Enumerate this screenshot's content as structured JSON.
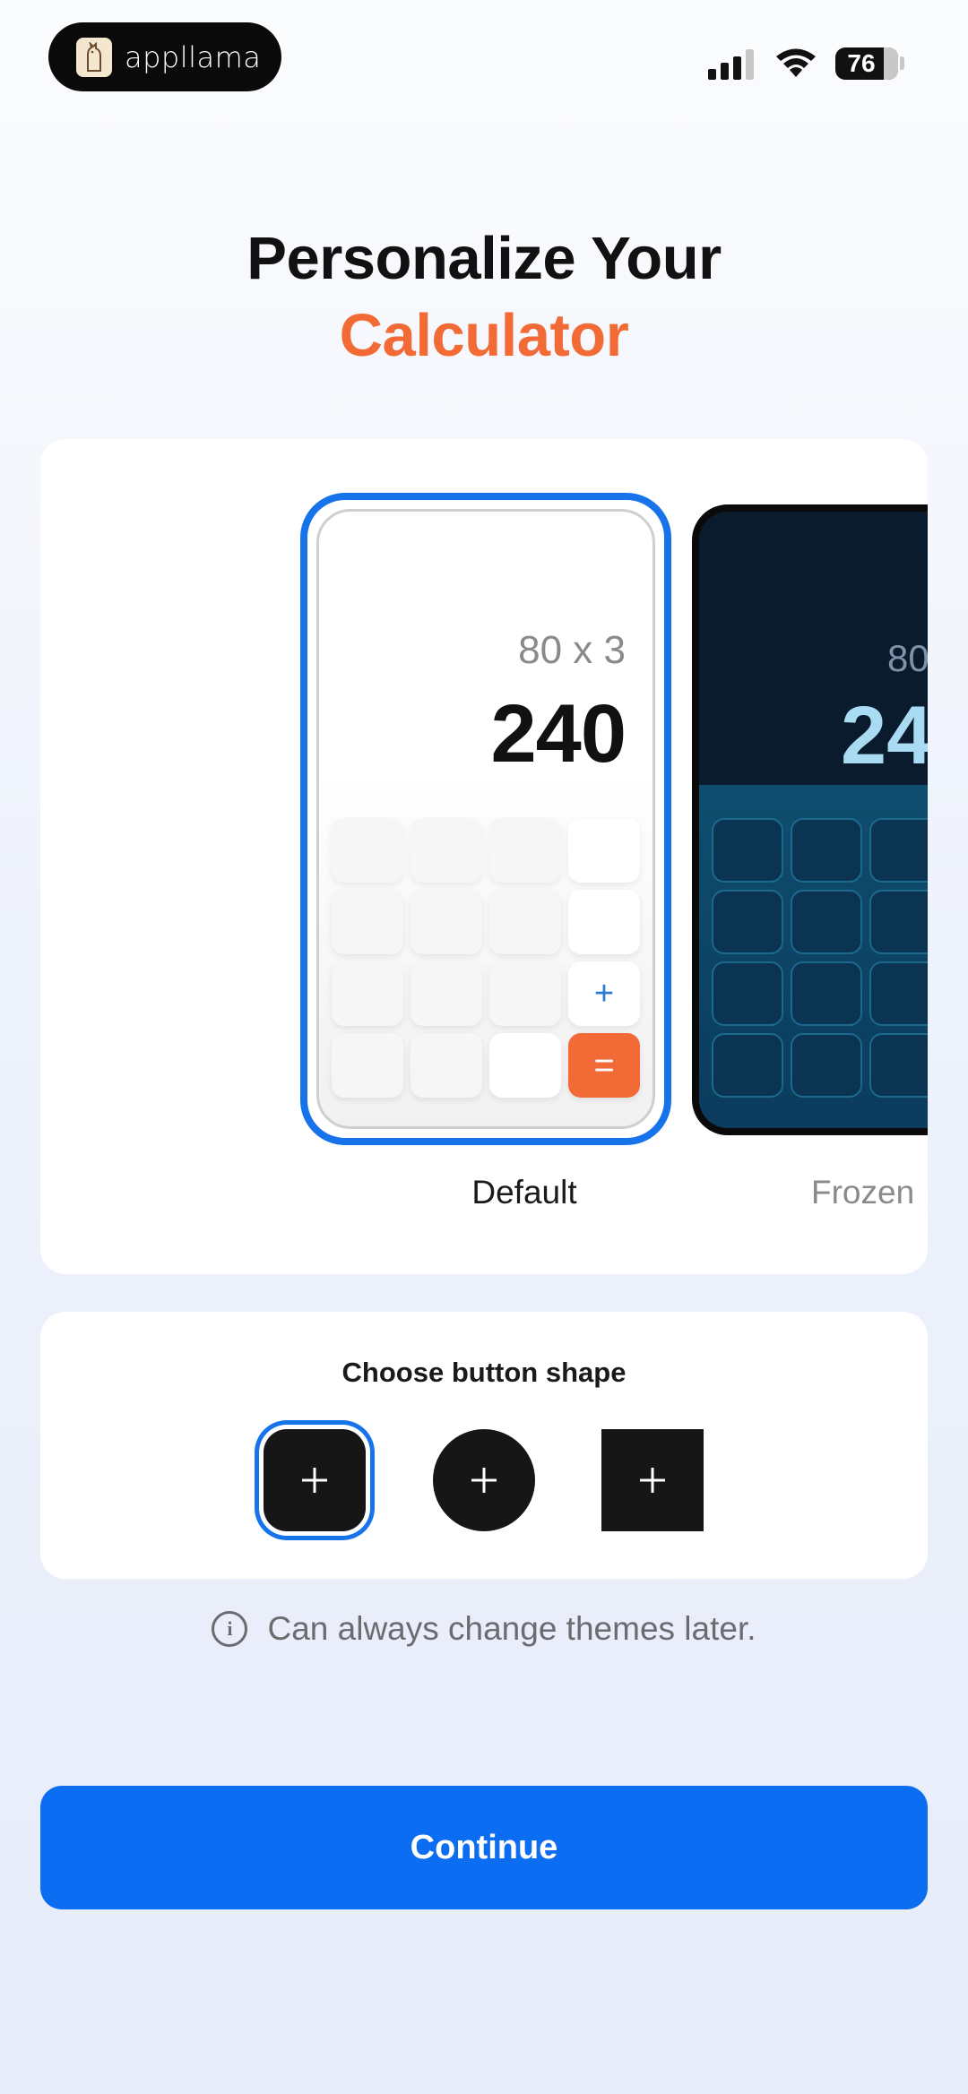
{
  "status_bar": {
    "app_badge": "appllama",
    "battery": "76",
    "icons": [
      "signal-icon",
      "wifi-icon",
      "battery-icon"
    ]
  },
  "header": {
    "title_line1": "Personalize Your",
    "title_line2": "Calculator",
    "accent_color": "#f26a35"
  },
  "themes": {
    "selected": "Default",
    "items": [
      {
        "label": "Default",
        "expression": "80 x 3",
        "result": "240",
        "keys": [
          "+",
          "="
        ]
      },
      {
        "label": "Frozen",
        "expression": "80",
        "result": "24"
      }
    ]
  },
  "shape_picker": {
    "title": "Choose button shape",
    "options": [
      {
        "name": "rounded",
        "glyph": "+",
        "selected": true
      },
      {
        "name": "circle",
        "glyph": "+",
        "selected": false
      },
      {
        "name": "square",
        "glyph": "+",
        "selected": false
      }
    ]
  },
  "note": {
    "text": "Can always change themes later."
  },
  "primary_button": {
    "label": "Continue",
    "color": "#0a6df2"
  }
}
